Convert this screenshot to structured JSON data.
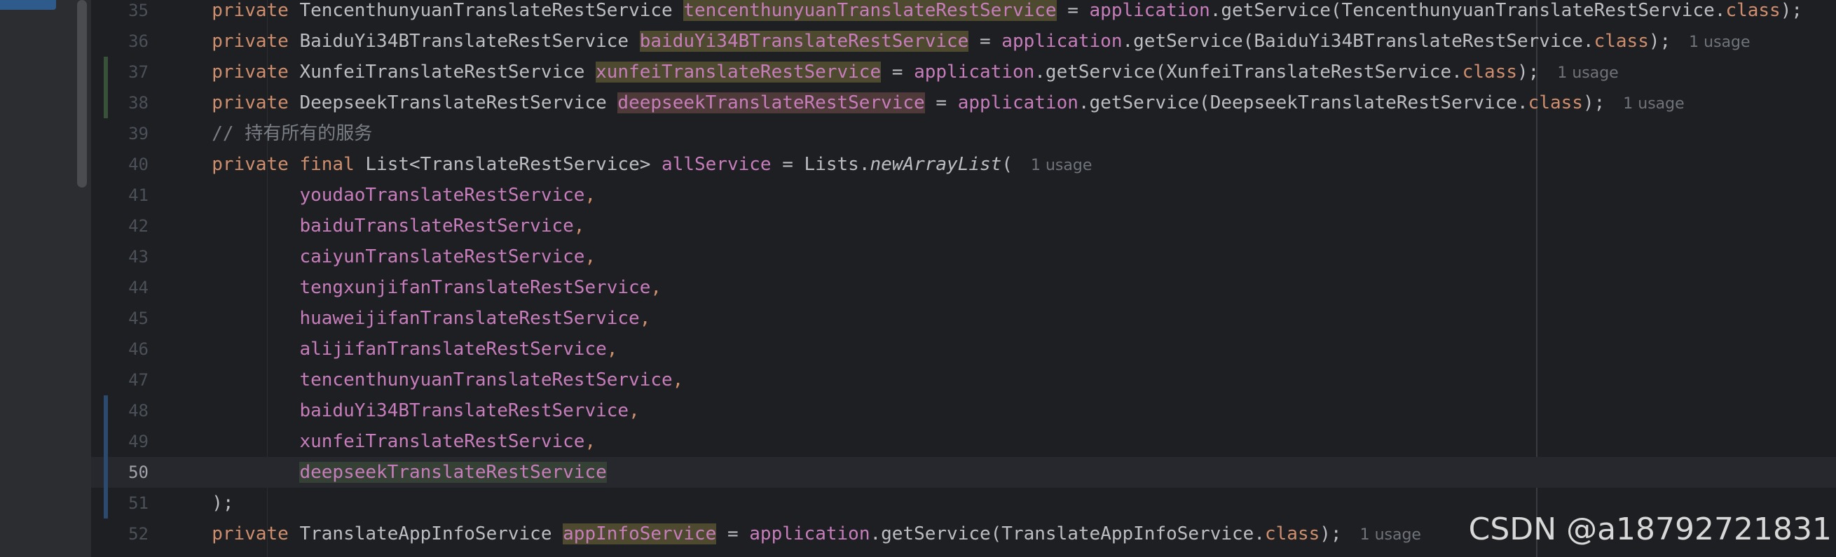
{
  "editor": {
    "lines": [
      {
        "num": "35",
        "vcs": "",
        "current": false,
        "segments": [
          {
            "t": "        "
          },
          {
            "t": "private",
            "c": "kw"
          },
          {
            "t": " TencenthunyuanTranslateRestService "
          },
          {
            "t": "tencenthunyuanTranslateRestService",
            "c": "fld hl-read"
          },
          {
            "t": " = "
          },
          {
            "t": "application",
            "c": "fld"
          },
          {
            "t": ".getService(TencenthunyuanTranslateRestService."
          },
          {
            "t": "class",
            "c": "kw"
          },
          {
            "t": ");"
          }
        ],
        "usage": ""
      },
      {
        "num": "36",
        "vcs": "",
        "current": false,
        "segments": [
          {
            "t": "        "
          },
          {
            "t": "private",
            "c": "kw"
          },
          {
            "t": " BaiduYi34BTranslateRestService "
          },
          {
            "t": "baiduYi34BTranslateRestService",
            "c": "fld hl-read"
          },
          {
            "t": " = "
          },
          {
            "t": "application",
            "c": "fld"
          },
          {
            "t": ".getService(BaiduYi34BTranslateRestService."
          },
          {
            "t": "class",
            "c": "kw"
          },
          {
            "t": ");"
          }
        ],
        "usage": "1 usage"
      },
      {
        "num": "37",
        "vcs": "added",
        "current": false,
        "segments": [
          {
            "t": "        "
          },
          {
            "t": "private",
            "c": "kw"
          },
          {
            "t": " XunfeiTranslateRestService "
          },
          {
            "t": "xunfeiTranslateRestService",
            "c": "fld hl-read"
          },
          {
            "t": " = "
          },
          {
            "t": "application",
            "c": "fld"
          },
          {
            "t": ".getService(XunfeiTranslateRestService."
          },
          {
            "t": "class",
            "c": "kw"
          },
          {
            "t": ");"
          }
        ],
        "usage": "1 usage"
      },
      {
        "num": "38",
        "vcs": "added",
        "current": false,
        "segments": [
          {
            "t": "        "
          },
          {
            "t": "private",
            "c": "kw"
          },
          {
            "t": " DeepseekTranslateRestService "
          },
          {
            "t": "deepseekTranslateRestService",
            "c": "fld hl-write"
          },
          {
            "t": " = "
          },
          {
            "t": "application",
            "c": "fld"
          },
          {
            "t": ".getService(DeepseekTranslateRestService."
          },
          {
            "t": "class",
            "c": "kw"
          },
          {
            "t": ");"
          }
        ],
        "usage": "1 usage"
      },
      {
        "num": "39",
        "vcs": "",
        "current": false,
        "segments": [
          {
            "t": "        "
          },
          {
            "t": "// 持有所有的服务",
            "c": "cmt"
          }
        ],
        "usage": ""
      },
      {
        "num": "40",
        "vcs": "",
        "current": false,
        "segments": [
          {
            "t": "        "
          },
          {
            "t": "private",
            "c": "kw"
          },
          {
            "t": " "
          },
          {
            "t": "final",
            "c": "kw"
          },
          {
            "t": " List<TranslateRestService> "
          },
          {
            "t": "allService",
            "c": "fld"
          },
          {
            "t": " = Lists."
          },
          {
            "t": "newArrayList",
            "c": "static-fn"
          },
          {
            "t": "("
          }
        ],
        "usage": "1 usage"
      },
      {
        "num": "41",
        "vcs": "",
        "current": false,
        "segments": [
          {
            "t": "                "
          },
          {
            "t": "youdaoTranslateRestService",
            "c": "fld"
          },
          {
            "t": ",",
            "c": "kw"
          }
        ],
        "usage": ""
      },
      {
        "num": "42",
        "vcs": "",
        "current": false,
        "segments": [
          {
            "t": "                "
          },
          {
            "t": "baiduTranslateRestService",
            "c": "fld"
          },
          {
            "t": ",",
            "c": "kw"
          }
        ],
        "usage": ""
      },
      {
        "num": "43",
        "vcs": "",
        "current": false,
        "segments": [
          {
            "t": "                "
          },
          {
            "t": "caiyunTranslateRestService",
            "c": "fld"
          },
          {
            "t": ",",
            "c": "kw"
          }
        ],
        "usage": ""
      },
      {
        "num": "44",
        "vcs": "",
        "current": false,
        "segments": [
          {
            "t": "                "
          },
          {
            "t": "tengxunjifanTranslateRestService",
            "c": "fld"
          },
          {
            "t": ",",
            "c": "kw"
          }
        ],
        "usage": ""
      },
      {
        "num": "45",
        "vcs": "",
        "current": false,
        "segments": [
          {
            "t": "                "
          },
          {
            "t": "huaweijifanTranslateRestService",
            "c": "fld"
          },
          {
            "t": ",",
            "c": "kw"
          }
        ],
        "usage": ""
      },
      {
        "num": "46",
        "vcs": "",
        "current": false,
        "segments": [
          {
            "t": "                "
          },
          {
            "t": "alijifanTranslateRestService",
            "c": "fld"
          },
          {
            "t": ",",
            "c": "kw"
          }
        ],
        "usage": ""
      },
      {
        "num": "47",
        "vcs": "",
        "current": false,
        "segments": [
          {
            "t": "                "
          },
          {
            "t": "tencenthunyuanTranslateRestService",
            "c": "fld"
          },
          {
            "t": ",",
            "c": "kw"
          }
        ],
        "usage": ""
      },
      {
        "num": "48",
        "vcs": "modified",
        "current": false,
        "segments": [
          {
            "t": "                "
          },
          {
            "t": "baiduYi34BTranslateRestService",
            "c": "fld"
          },
          {
            "t": ",",
            "c": "kw"
          }
        ],
        "usage": ""
      },
      {
        "num": "49",
        "vcs": "modified",
        "current": false,
        "segments": [
          {
            "t": "                "
          },
          {
            "t": "xunfeiTranslateRestService",
            "c": "fld"
          },
          {
            "t": ",",
            "c": "kw"
          }
        ],
        "usage": ""
      },
      {
        "num": "50",
        "vcs": "modified",
        "current": true,
        "segments": [
          {
            "t": "                "
          },
          {
            "t": "deepseekTranslateRestService",
            "c": "fld hl-caret"
          }
        ],
        "usage": ""
      },
      {
        "num": "51",
        "vcs": "modified",
        "current": false,
        "segments": [
          {
            "t": "        "
          },
          {
            "t": ");"
          }
        ],
        "usage": ""
      },
      {
        "num": "52",
        "vcs": "",
        "current": false,
        "segments": [
          {
            "t": "        "
          },
          {
            "t": "private",
            "c": "kw"
          },
          {
            "t": " TranslateAppInfoService "
          },
          {
            "t": "appInfoService",
            "c": "fld hl-read"
          },
          {
            "t": " = "
          },
          {
            "t": "application",
            "c": "fld"
          },
          {
            "t": ".getService(TranslateAppInfoService."
          },
          {
            "t": "class",
            "c": "kw"
          },
          {
            "t": ");"
          }
        ],
        "usage": "1 usage"
      }
    ]
  },
  "watermark": "CSDN @a18792721831",
  "colors": {
    "background": "#1e1f22",
    "keyword": "#cf8e6d",
    "field": "#c77dbb",
    "comment": "#7a7e85",
    "text": "#bcbec4",
    "line_number": "#4b5059"
  }
}
